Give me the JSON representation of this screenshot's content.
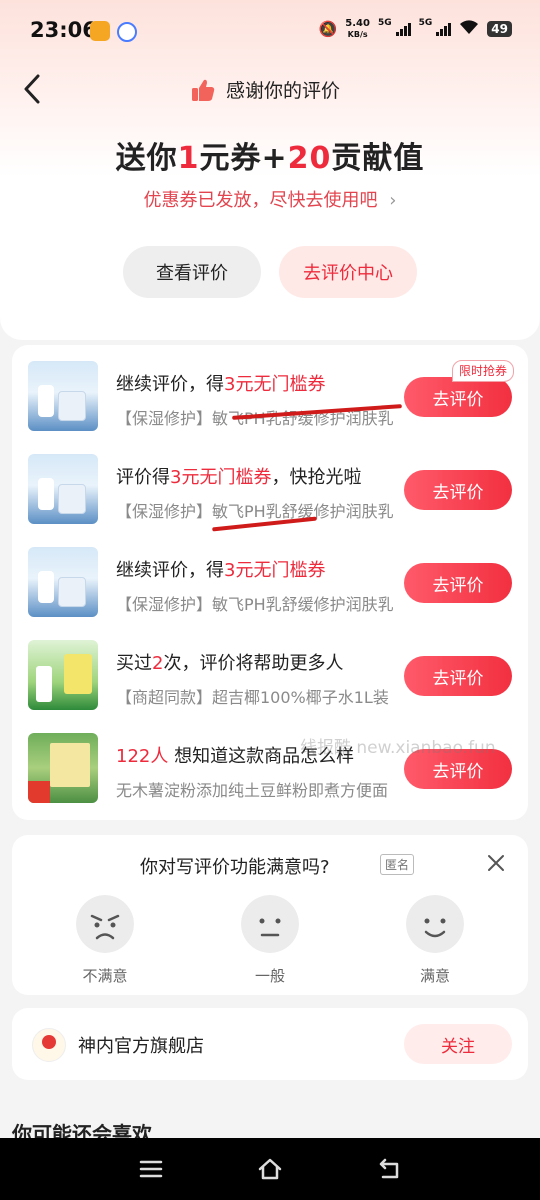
{
  "status_bar": {
    "time": "23:06",
    "speed_value": "5.40",
    "speed_unit": "KB/s",
    "network_1": "5G",
    "network_2": "5G",
    "battery": "49"
  },
  "header": {
    "title": "感谢你的评价",
    "icon": "thumbs-up-icon"
  },
  "reward": {
    "prefix": "送你",
    "num1": "1",
    "mid": "元券+",
    "num2": "20",
    "suffix": "贡献值",
    "subtitle": "优惠券已发放，尽快去使用吧",
    "subtitle_arrow": "›"
  },
  "actions": {
    "view_review": "查看评价",
    "review_center": "去评价中心"
  },
  "products": [
    {
      "title_pre": "继续评价，得",
      "title_red": "3元无门槛券",
      "title_post": "",
      "desc": "【保湿修护】敏飞PH乳舒缓修护润肤乳",
      "button": "去评价",
      "tag": "限时抢券"
    },
    {
      "title_pre": "评价得",
      "title_red": "3元无门槛券",
      "title_post": "，快抢光啦",
      "desc": "【保湿修护】敏飞PH乳舒缓修护润肤乳",
      "button": "去评价"
    },
    {
      "title_pre": "继续评价，得",
      "title_red": "3元无门槛券",
      "title_post": "",
      "desc": "【保湿修护】敏飞PH乳舒缓修护润肤乳",
      "button": "去评价"
    },
    {
      "title_pre": "买过",
      "title_red": "2",
      "title_post": "次，评价将帮助更多人",
      "desc": "【商超同款】超吉椰100%椰子水1L装",
      "button": "去评价"
    },
    {
      "title_pre": "",
      "title_red": "122人",
      "title_post": " 想知道这款商品怎么样",
      "desc": "无木薯淀粉添加纯土豆鲜粉即煮方便面",
      "button": "去评价"
    }
  ],
  "watermark": "线报酷 new.xianbao.fun",
  "survey": {
    "question": "你对写评价功能满意吗?",
    "anonymous": "匿名",
    "options": [
      "不满意",
      "一般",
      "满意"
    ]
  },
  "store": {
    "name": "神内官方旗舰店",
    "follow": "关注"
  },
  "recommend_title": "你可能还会喜欢",
  "colors": {
    "accent": "#ee2b3c",
    "button_gradient_start": "#ff5a6a",
    "button_gradient_end": "#f23040",
    "annotation_red": "#d01b1b"
  }
}
